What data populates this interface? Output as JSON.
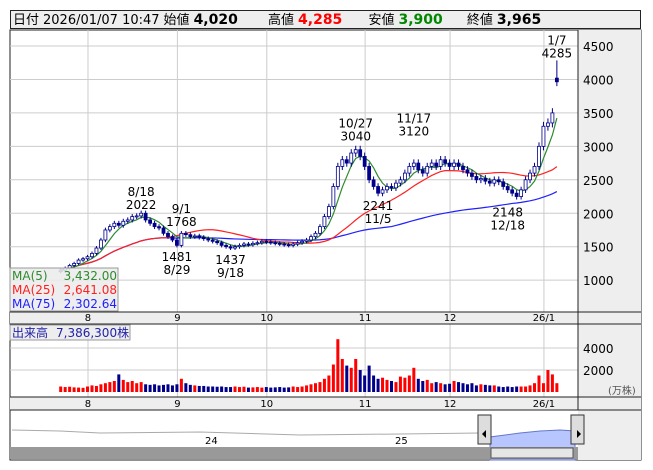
{
  "header": {
    "date_label": "日付",
    "datetime": "2026/01/07 10:47",
    "open_label": "始値",
    "open": "4,020",
    "high_label": "高値",
    "high": "4,285",
    "low_label": "安値",
    "low": "3,900",
    "close_label": "終値",
    "close": "3,965"
  },
  "colors": {
    "up": "#ff0000",
    "down": "#00008b",
    "ma5": "#2e8b2e",
    "ma25": "#ff2020",
    "ma75": "#2020ff",
    "high_text": "#ff0000",
    "low_text": "#008000"
  },
  "chart_data": {
    "type": "candlestick",
    "price_axis": {
      "ylim": [
        500,
        4700
      ],
      "ticks": [
        1000,
        1500,
        2000,
        2500,
        3000,
        3500,
        4000,
        4500
      ]
    },
    "x_ticks": [
      {
        "i": 7,
        "label": "8"
      },
      {
        "i": 27,
        "label": "9"
      },
      {
        "i": 47,
        "label": "10"
      },
      {
        "i": 69,
        "label": "11"
      },
      {
        "i": 88,
        "label": "12"
      },
      {
        "i": 109,
        "label": "26/1"
      }
    ],
    "closes": [
      1150,
      1180,
      1220,
      1250,
      1300,
      1320,
      1350,
      1400,
      1480,
      1600,
      1750,
      1800,
      1850,
      1820,
      1880,
      1900,
      1950,
      1960,
      2000,
      1900,
      1850,
      1800,
      1780,
      1700,
      1650,
      1600,
      1520,
      1700,
      1680,
      1650,
      1660,
      1640,
      1620,
      1600,
      1580,
      1560,
      1520,
      1500,
      1480,
      1500,
      1520,
      1540,
      1530,
      1550,
      1560,
      1580,
      1570,
      1560,
      1550,
      1540,
      1530,
      1520,
      1540,
      1560,
      1580,
      1600,
      1650,
      1700,
      1800,
      1950,
      2100,
      2400,
      2700,
      2800,
      2750,
      2900,
      2950,
      2850,
      2700,
      2500,
      2400,
      2300,
      2350,
      2400,
      2380,
      2450,
      2500,
      2600,
      2700,
      2750,
      2650,
      2600,
      2700,
      2750,
      2700,
      2800,
      2750,
      2700,
      2750,
      2700,
      2650,
      2600,
      2550,
      2500,
      2520,
      2480,
      2450,
      2500,
      2470,
      2400,
      2350,
      2300,
      2250,
      2350,
      2500,
      2600,
      2700,
      3000,
      3300,
      3350,
      3500,
      3965
    ],
    "last_candle": {
      "open": 4020,
      "high": 4285,
      "low": 3900,
      "close": 3965
    },
    "annotations": [
      {
        "i": 18,
        "price": 2022,
        "date": "8/18",
        "value": "2022",
        "pos": "above"
      },
      {
        "i": 27,
        "price": 1768,
        "date": "9/1",
        "value": "1768",
        "pos": "above"
      },
      {
        "i": 26,
        "price": 1481,
        "date": "8/29",
        "value": "1481",
        "pos": "below"
      },
      {
        "i": 38,
        "price": 1437,
        "date": "9/18",
        "value": "1437",
        "pos": "below"
      },
      {
        "i": 66,
        "price": 3040,
        "date": "10/27",
        "value": "3040",
        "pos": "above"
      },
      {
        "i": 71,
        "price": 2241,
        "date": "11/5",
        "value": "2241",
        "pos": "below"
      },
      {
        "i": 79,
        "price": 3120,
        "date": "11/17",
        "value": "3120",
        "pos": "above"
      },
      {
        "i": 100,
        "price": 2148,
        "date": "12/18",
        "value": "2148",
        "pos": "below"
      },
      {
        "i": 111,
        "price": 4285,
        "date": "1/7",
        "value": "4285",
        "pos": "above"
      }
    ],
    "ma_legend": [
      {
        "label": "MA(5)",
        "value": "3,432.00"
      },
      {
        "label": "MA(25)",
        "value": "2,641.08"
      },
      {
        "label": "MA(75)",
        "value": "2,302.64"
      }
    ],
    "volume": {
      "label": "出来高",
      "value": "7,386,300株",
      "unit": "(万株)",
      "ticks": [
        2000,
        4000
      ],
      "values": [
        500,
        450,
        480,
        420,
        400,
        380,
        500,
        600,
        550,
        700,
        800,
        900,
        1000,
        1600,
        1100,
        900,
        1000,
        800,
        900,
        700,
        650,
        700,
        600,
        650,
        700,
        600,
        700,
        1200,
        800,
        650,
        600,
        550,
        550,
        500,
        500,
        480,
        500,
        450,
        450,
        500,
        450,
        480,
        400,
        420,
        450,
        400,
        450,
        400,
        420,
        450,
        400,
        420,
        500,
        450,
        500,
        600,
        700,
        800,
        900,
        1200,
        1500,
        2500,
        4800,
        3000,
        2400,
        2200,
        3000,
        2000,
        1500,
        2400,
        1500,
        1200,
        1300,
        1100,
        1000,
        900,
        1400,
        1300,
        1500,
        2200,
        1200,
        1000,
        1100,
        800,
        900,
        800,
        700,
        750,
        1000,
        900,
        800,
        700,
        800,
        600,
        700,
        650,
        600,
        600,
        500,
        450,
        500,
        450,
        500,
        500,
        500,
        600,
        800,
        1500,
        800,
        2000,
        1600,
        800
      ]
    },
    "navigator": {
      "labels": [
        "24",
        "25"
      ]
    }
  }
}
